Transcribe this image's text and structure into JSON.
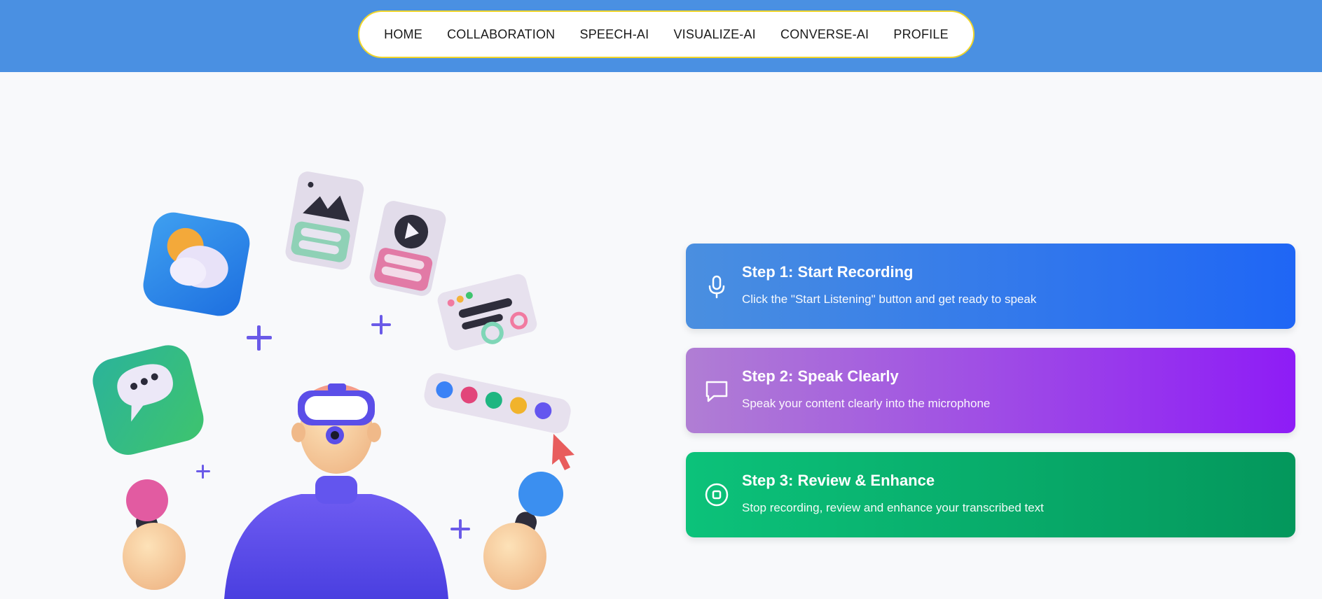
{
  "nav": {
    "items": [
      {
        "label": "HOME"
      },
      {
        "label": "COLLABORATION"
      },
      {
        "label": "SPEECH-AI"
      },
      {
        "label": "VISUALIZE-AI"
      },
      {
        "label": "CONVERSE-AI"
      },
      {
        "label": "PROFILE"
      }
    ]
  },
  "colors": {
    "header_bg": "#4a90e2",
    "nav_border": "#f0d52a",
    "step1_gradient": [
      "#4a8fe0",
      "#1f66f5"
    ],
    "step2_gradient": [
      "#b07ed4",
      "#8e1cf6"
    ],
    "step3_gradient": [
      "#0cc27a",
      "#04975c"
    ]
  },
  "steps": [
    {
      "icon": "microphone-icon",
      "title": "Step 1: Start Recording",
      "description": "Click the \"Start Listening\" button and get ready to speak"
    },
    {
      "icon": "chat-bubble-icon",
      "title": "Step 2: Speak Clearly",
      "description": "Speak your content clearly into the microphone"
    },
    {
      "icon": "stop-icon",
      "title": "Step 3: Review & Enhance",
      "description": "Stop recording, review and enhance your transcribed text"
    }
  ],
  "hero": {
    "illustration": "3d-vr-person-with-microphones-illustration"
  }
}
